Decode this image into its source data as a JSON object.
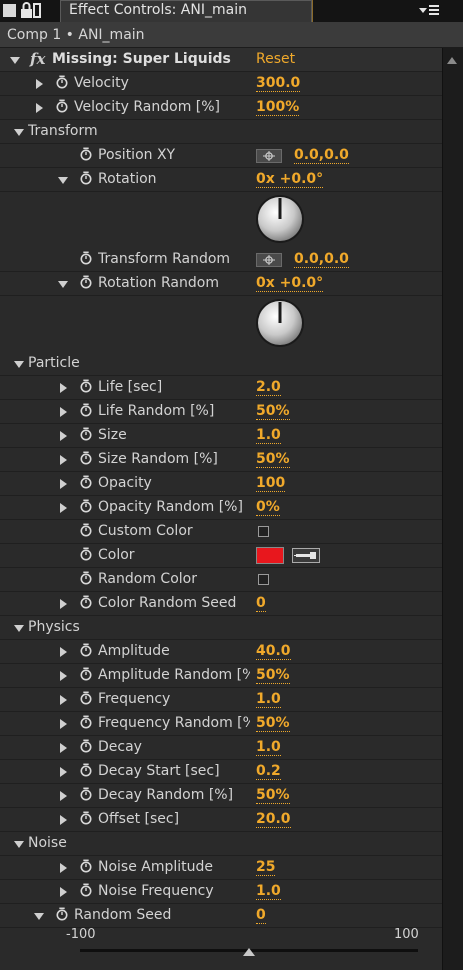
{
  "tab": {
    "title": "Effect Controls: ANI_main"
  },
  "subheader": {
    "comp_label": "Comp 1 • ANI_main"
  },
  "effect": {
    "name": "Missing: Super Liquids",
    "reset_label": "Reset"
  },
  "colors": {
    "value": "#f0a92b",
    "swatch": "#e8171d",
    "background": "#2a2a2a"
  },
  "rows": [
    {
      "type": "prop",
      "indent": 1,
      "label": "Velocity",
      "value": "300.0"
    },
    {
      "type": "prop",
      "indent": 1,
      "label": "Velocity Random [%]",
      "value": "100%"
    },
    {
      "type": "group",
      "indent": 1,
      "label": "Transform"
    },
    {
      "type": "point",
      "indent": 2,
      "label": "Position XY",
      "value": "0.0,0.0"
    },
    {
      "type": "angle",
      "indent": 2,
      "label": "Rotation",
      "value": "0x +0.0°"
    },
    {
      "type": "point",
      "indent": 2,
      "label": "Transform Random",
      "value": "0.0,0.0"
    },
    {
      "type": "angle",
      "indent": 2,
      "label": "Rotation Random",
      "value": "0x +0.0°"
    },
    {
      "type": "group",
      "indent": 1,
      "label": "Particle"
    },
    {
      "type": "prop",
      "indent": 2,
      "label": "Life [sec]",
      "value": "2.0"
    },
    {
      "type": "prop",
      "indent": 2,
      "label": "Life Random [%]",
      "value": "50%"
    },
    {
      "type": "prop",
      "indent": 2,
      "label": "Size",
      "value": "1.0"
    },
    {
      "type": "prop",
      "indent": 2,
      "label": "Size Random [%]",
      "value": "50%"
    },
    {
      "type": "prop",
      "indent": 2,
      "label": "Opacity",
      "value": "100"
    },
    {
      "type": "prop",
      "indent": 2,
      "label": "Opacity Random [%]",
      "value": "0%"
    },
    {
      "type": "checkbox",
      "indent": 2,
      "label": "Custom Color"
    },
    {
      "type": "color",
      "indent": 2,
      "label": "Color"
    },
    {
      "type": "checkbox",
      "indent": 2,
      "label": "Random Color"
    },
    {
      "type": "prop",
      "indent": 2,
      "label": "Color Random Seed",
      "value": "0"
    },
    {
      "type": "group",
      "indent": 1,
      "label": "Physics"
    },
    {
      "type": "prop",
      "indent": 2,
      "label": "Amplitude",
      "value": "40.0"
    },
    {
      "type": "prop",
      "indent": 2,
      "label": "Amplitude Random [%]",
      "value": "50%"
    },
    {
      "type": "prop",
      "indent": 2,
      "label": "Frequency",
      "value": "1.0"
    },
    {
      "type": "prop",
      "indent": 2,
      "label": "Frequency Random [%]",
      "value": "50%"
    },
    {
      "type": "prop",
      "indent": 2,
      "label": "Decay",
      "value": "1.0"
    },
    {
      "type": "prop",
      "indent": 2,
      "label": "Decay Start [sec]",
      "value": "0.2"
    },
    {
      "type": "prop",
      "indent": 2,
      "label": "Decay Random [%]",
      "value": "50%"
    },
    {
      "type": "prop",
      "indent": 2,
      "label": "Offset [sec]",
      "value": "20.0"
    },
    {
      "type": "group",
      "indent": 1,
      "label": "Noise"
    },
    {
      "type": "prop",
      "indent": 2,
      "label": "Noise Amplitude",
      "value": "25"
    },
    {
      "type": "prop",
      "indent": 2,
      "label": "Noise Frequency",
      "value": "1.0"
    },
    {
      "type": "slider",
      "indent": 1,
      "label": "Random Seed",
      "value": "0",
      "min": "-100",
      "max": "100",
      "level": 0
    }
  ]
}
